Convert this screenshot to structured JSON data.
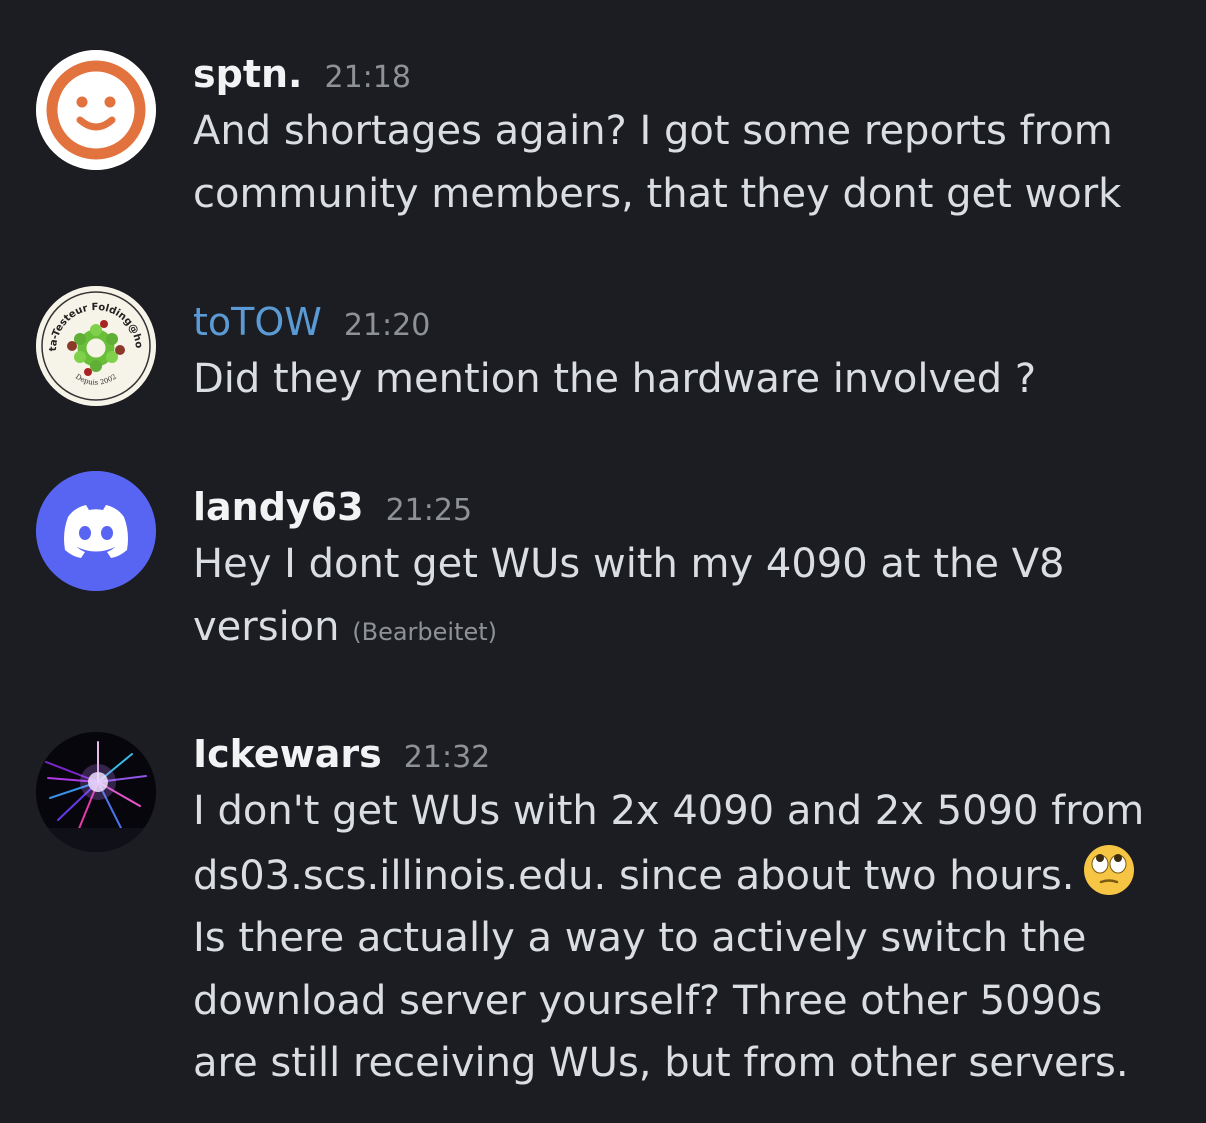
{
  "messages": [
    {
      "username": "sptn.",
      "time": "21:18",
      "text": "And shortages again? I got some reports from\ncommunity members, that they dont get work",
      "avatar_icon": "smiley-face-icon"
    },
    {
      "username": "toTOW",
      "time": "21:20",
      "text": "Did they mention the hardware involved ?",
      "avatar_icon": "beta-testeur-folding-at-home-badge",
      "avatar_text_top": "Beta-Testeur Folding@home",
      "avatar_text_bottom": "Depuis 2002"
    },
    {
      "username": "landy63",
      "time": "21:25",
      "text": "Hey I dont get WUs with my 4090 at the V8\nversion",
      "edited": "(Bearbeitet)",
      "avatar_icon": "discord-logo-icon"
    },
    {
      "username": "Ickewars",
      "time": "21:32",
      "text_before_emoji": "I don't get WUs with 2x 4090 and 2x 5090 from\nds03.scs.illinois.edu. since about two hours.",
      "emoji": "rolling-eyes-emoji",
      "text_after_emoji": "Is there actually a way to actively switch the\ndownload server yourself? Three other 5090s\nare still receiving WUs, but from other servers.",
      "avatar_icon": "laser-light-show-photo"
    }
  ],
  "colors": {
    "background": "#1c1d22",
    "username_default": "#f2f3f5",
    "username_totow": "#5b9bd5",
    "timestamp": "#8e9297",
    "message_text": "#dbdee1",
    "discord_blurple": "#5865f2",
    "smiley_orange": "#e2733f"
  }
}
